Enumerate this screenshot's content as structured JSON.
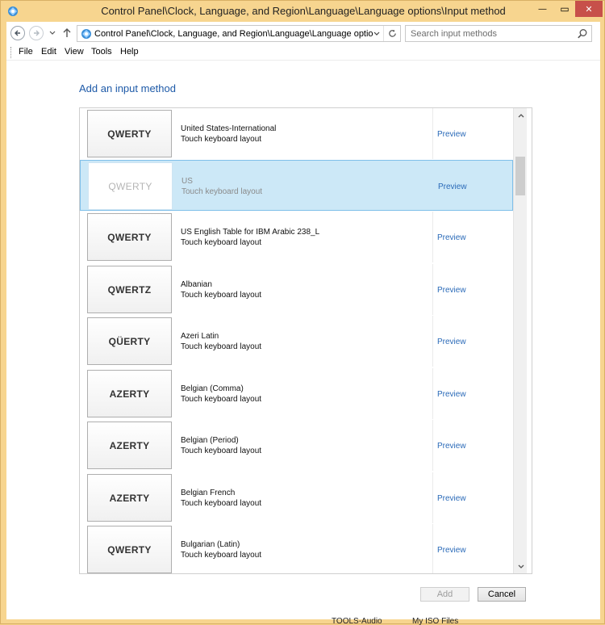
{
  "window": {
    "title": "Control Panel\\Clock, Language, and Region\\Language\\Language options\\Input method",
    "minimize_glyph": "—",
    "maximize_glyph": "▭",
    "close_glyph": "✕"
  },
  "address": {
    "path": "Control Panel\\Clock, Language, and Region\\Language\\Language options\\Input",
    "search_placeholder": "Search input methods",
    "icon": "control-panel-icon"
  },
  "menu": {
    "file": "File",
    "edit": "Edit",
    "view": "View",
    "tools": "Tools",
    "help": "Help"
  },
  "heading": "Add an input method",
  "items": [
    {
      "kbd": "QWERTY",
      "name": "United States-International",
      "sub": "Touch keyboard layout",
      "preview": "Preview",
      "selected": false
    },
    {
      "kbd": "QWERTY",
      "name": "US",
      "sub": "Touch keyboard layout",
      "preview": "Preview",
      "selected": true
    },
    {
      "kbd": "QWERTY",
      "name": "US English Table for IBM Arabic 238_L",
      "sub": "Touch keyboard layout",
      "preview": "Preview",
      "selected": false
    },
    {
      "kbd": "QWERTZ",
      "name": "Albanian",
      "sub": "Touch keyboard layout",
      "preview": "Preview",
      "selected": false
    },
    {
      "kbd": "QÜERTY",
      "name": "Azeri Latin",
      "sub": "Touch keyboard layout",
      "preview": "Preview",
      "selected": false
    },
    {
      "kbd": "AZERTY",
      "name": "Belgian (Comma)",
      "sub": "Touch keyboard layout",
      "preview": "Preview",
      "selected": false
    },
    {
      "kbd": "AZERTY",
      "name": "Belgian (Period)",
      "sub": "Touch keyboard layout",
      "preview": "Preview",
      "selected": false
    },
    {
      "kbd": "AZERTY",
      "name": "Belgian French",
      "sub": "Touch keyboard layout",
      "preview": "Preview",
      "selected": false
    },
    {
      "kbd": "QWERTY",
      "name": "Bulgarian (Latin)",
      "sub": "Touch keyboard layout",
      "preview": "Preview",
      "selected": false
    }
  ],
  "buttons": {
    "add": "Add",
    "cancel": "Cancel"
  },
  "taskbar": {
    "item1": "TOOLS-Audio",
    "item2": "My ISO Files"
  },
  "colors": {
    "frame": "#f7d58f",
    "accent_link": "#2a6ab8",
    "heading": "#1e5aa8",
    "selection": "#cce8f7",
    "close": "#c7504a"
  }
}
